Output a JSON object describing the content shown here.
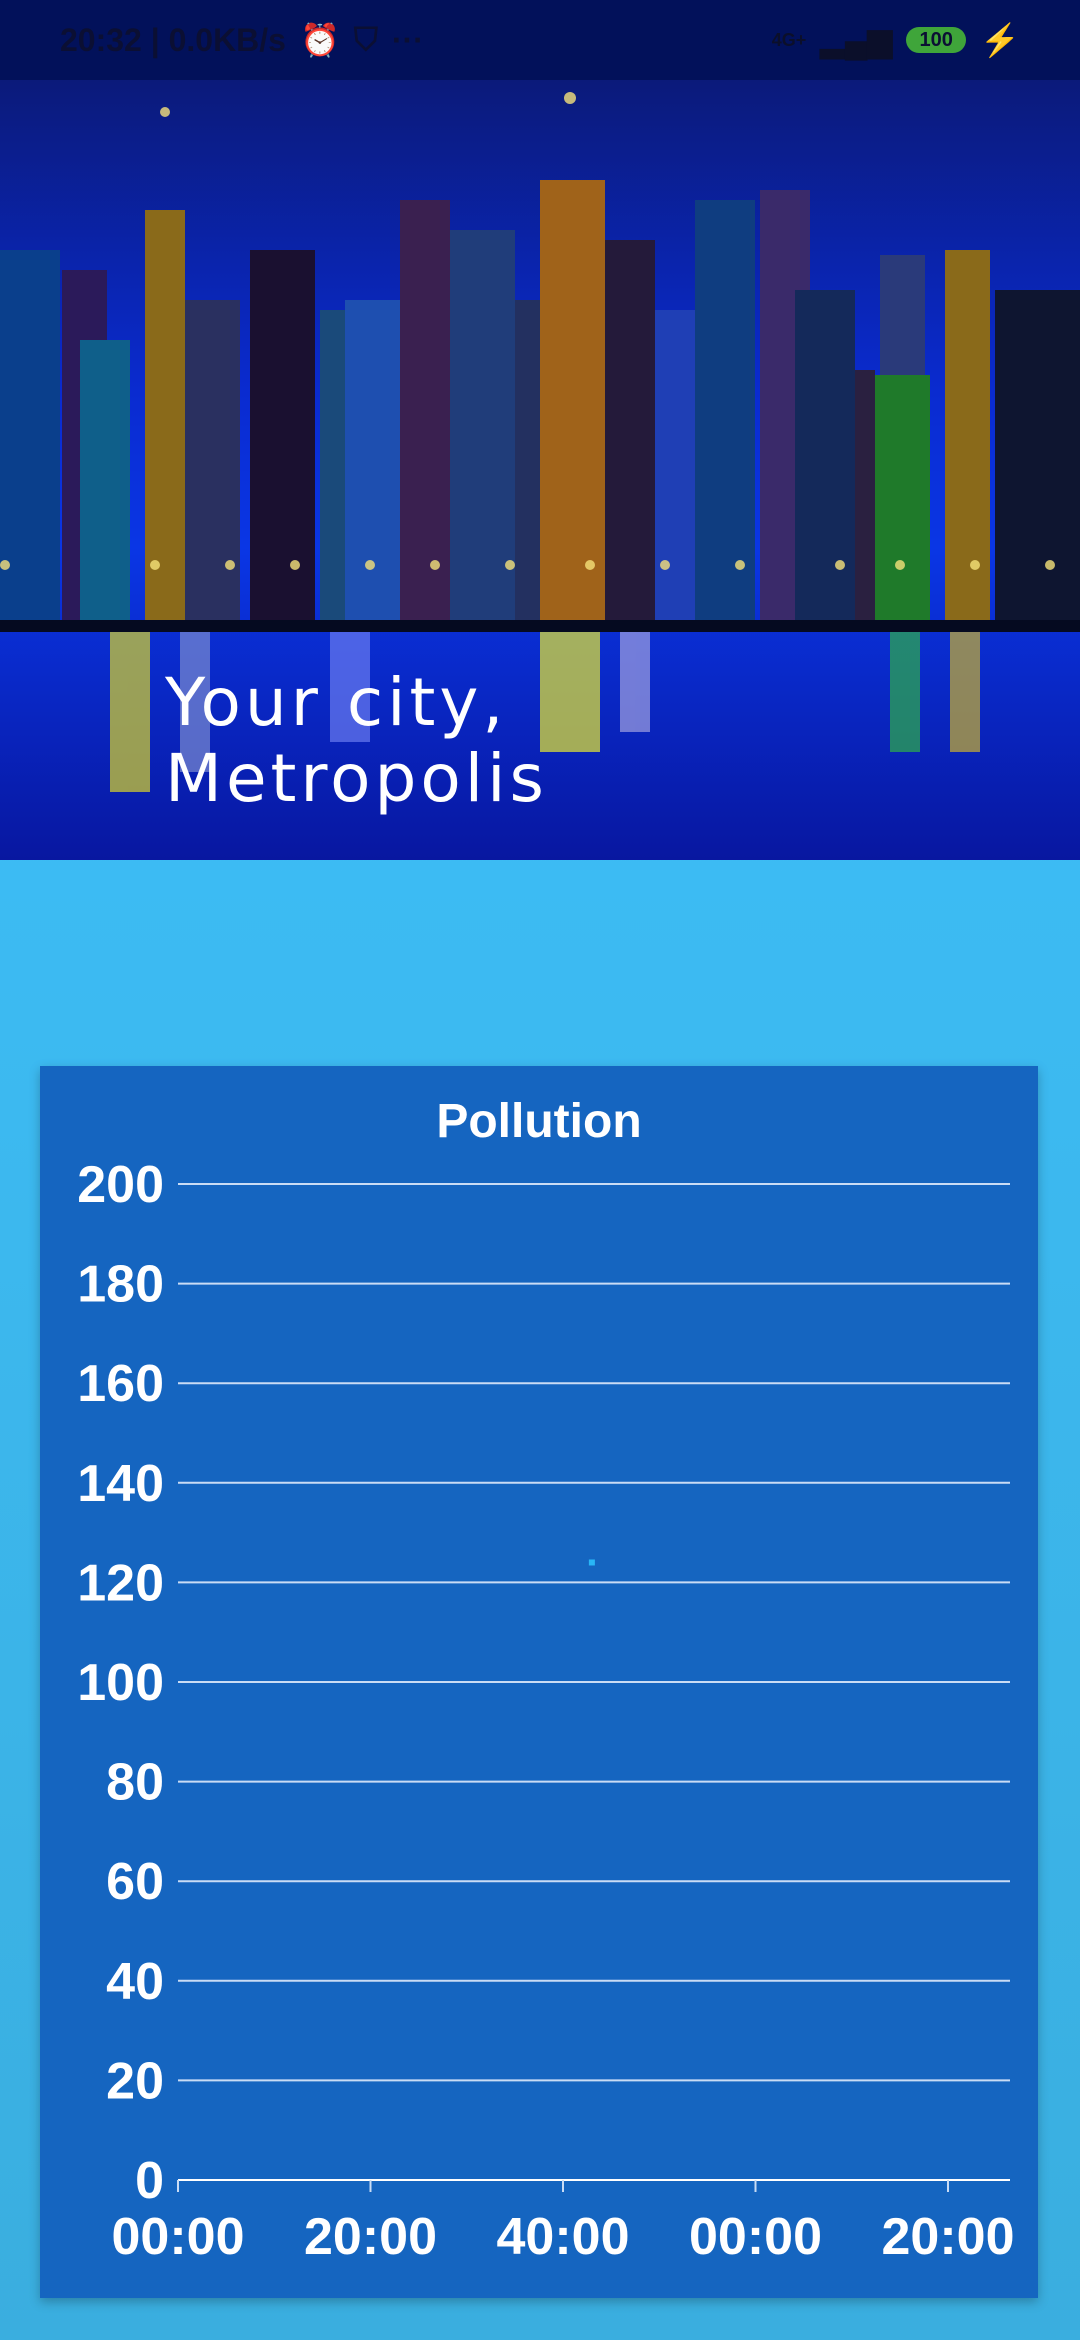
{
  "status_bar": {
    "time_and_speed": "20:32 | 0.0KB/s",
    "dots": "···",
    "battery": "100",
    "network": "4G+"
  },
  "hero": {
    "title_line1": "Your city,",
    "title_line2": "Metropolis"
  },
  "chart_data": {
    "type": "scatter",
    "title": "Pollution",
    "xlabel": "",
    "ylabel": "",
    "ylim": [
      0,
      200
    ],
    "y_ticks": [
      "200",
      "180",
      "160",
      "140",
      "120",
      "100",
      "80",
      "60",
      "40",
      "20",
      "0"
    ],
    "x_ticks": [
      "00:00",
      "20:00",
      "40:00",
      "00:00",
      "20:00"
    ],
    "series": [
      {
        "points": [
          {
            "x": "43:00",
            "y": 124
          }
        ]
      }
    ],
    "point_color": "#29b6f6",
    "grid": true
  }
}
